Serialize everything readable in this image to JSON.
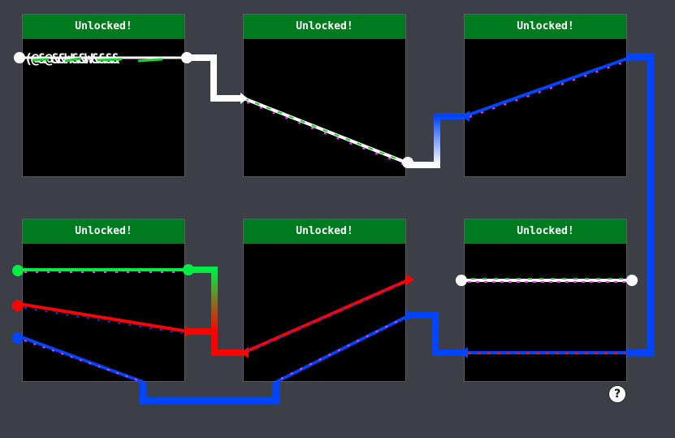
{
  "panels": [
    {
      "id": "p1",
      "status": "Unlocked!"
    },
    {
      "id": "p2",
      "status": "Unlocked!"
    },
    {
      "id": "p3",
      "status": "Unlocked!"
    },
    {
      "id": "p4",
      "status": "Unlocked!"
    },
    {
      "id": "p5",
      "status": "Unlocked!"
    },
    {
      "id": "p6",
      "status": "Unlocked!"
    }
  ],
  "help": {
    "label": "?"
  },
  "colors": {
    "background": "#3c4046",
    "header": "#007a1f",
    "white_wire": "#ffffff",
    "blue_wire": "#0044ff",
    "red_wire": "#ff0000",
    "green_wire": "#00ee44",
    "noise": "#ff33ff"
  },
  "icons": [
    "help-icon",
    "endpoint-node",
    "arrow-node"
  ]
}
